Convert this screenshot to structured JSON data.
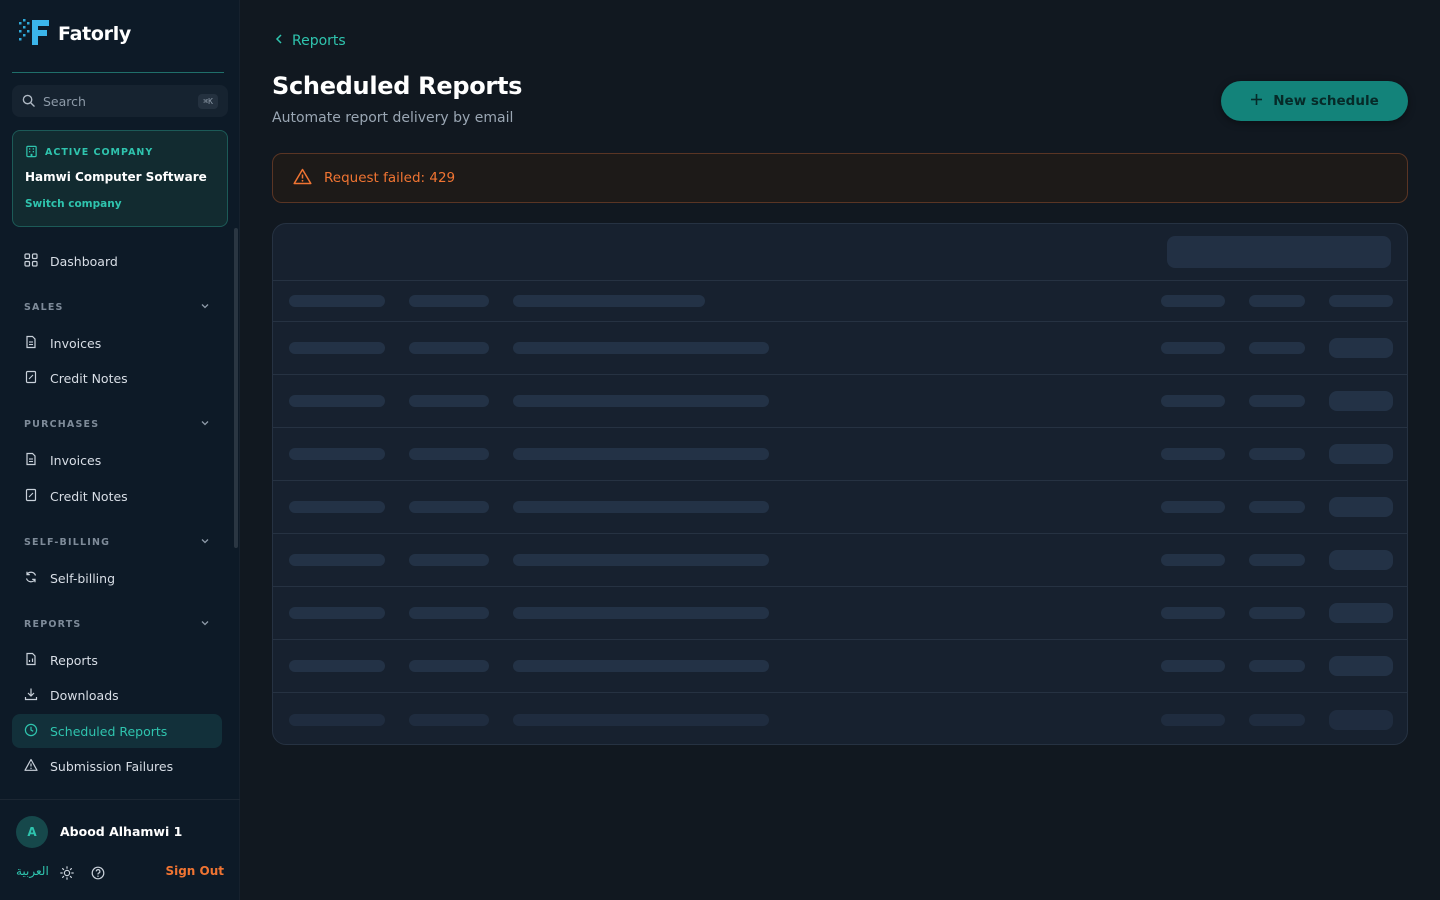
{
  "sidebar": {
    "brand": "Fatorly",
    "search": {
      "placeholder": "Search",
      "shortcut": "⌘K"
    },
    "company": {
      "label": "ACTIVE COMPANY",
      "name": "Hamwi Computer Software",
      "switch_label": "Switch company"
    },
    "dashboard": "Dashboard",
    "sections": {
      "sales": {
        "title": "SALES",
        "items": [
          "Invoices",
          "Credit Notes"
        ]
      },
      "purchases": {
        "title": "PURCHASES",
        "items": [
          "Invoices",
          "Credit Notes"
        ]
      },
      "self_billing": {
        "title": "SELF-BILLING",
        "items": [
          "Self-billing"
        ]
      },
      "reports": {
        "title": "REPORTS",
        "items": [
          "Reports",
          "Downloads",
          "Scheduled Reports",
          "Submission Failures"
        ]
      }
    },
    "active_item": "Scheduled Reports",
    "user": {
      "initial": "A",
      "name": "Abood Alhamwi 1"
    },
    "footer": {
      "language": "العربية",
      "sign_out": "Sign Out"
    }
  },
  "main": {
    "breadcrumb": "Reports",
    "title": "Scheduled Reports",
    "subtitle": "Automate report delivery by email",
    "new_button": "New schedule",
    "alert": "Request failed: 429"
  },
  "colors": {
    "accent": "#2fc4ae",
    "primary_button": "#13837a",
    "error": "#f07432",
    "background": "#111820",
    "sidebar": "#0d1a27"
  },
  "table": {
    "state": "loading",
    "skeleton_rows": 8
  }
}
